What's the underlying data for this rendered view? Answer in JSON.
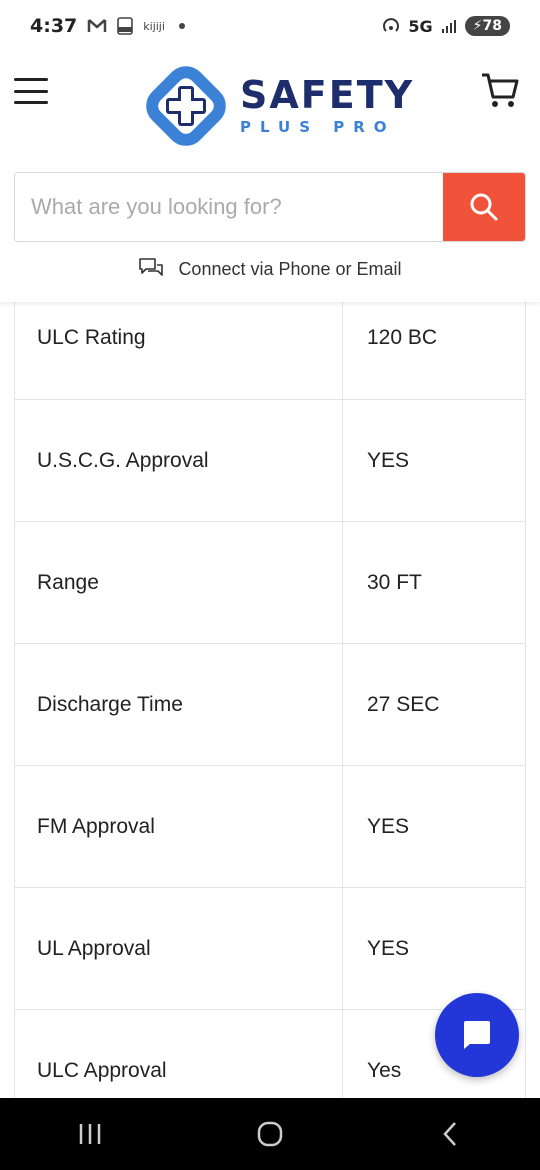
{
  "status_bar": {
    "time": "4:37",
    "notif_text": "kijiji",
    "network": "5G",
    "battery": "78"
  },
  "header": {
    "logo_name": "SAFETY",
    "logo_sub": "PLUS PRO",
    "search_placeholder": "What are you looking for?",
    "connect_label": "Connect via Phone or Email"
  },
  "specs": [
    {
      "label": "ULC Rating",
      "value": "120 BC"
    },
    {
      "label": "U.S.C.G. Approval",
      "value": "YES"
    },
    {
      "label": "Range",
      "value": "30 FT"
    },
    {
      "label": "Discharge Time",
      "value": "27 SEC"
    },
    {
      "label": "FM Approval",
      "value": "YES"
    },
    {
      "label": "UL Approval",
      "value": "YES"
    },
    {
      "label": "ULC Approval",
      "value": "Yes"
    }
  ],
  "colors": {
    "search_button": "#f0533a",
    "chat_button": "#2336d8",
    "logo_navy": "#1e2d6b",
    "logo_blue": "#3b82d6"
  },
  "icons": {
    "menu": "hamburger-menu-icon",
    "cart": "cart-icon",
    "search": "search-icon",
    "connect": "chat-bubbles-icon",
    "chat": "chat-icon"
  }
}
